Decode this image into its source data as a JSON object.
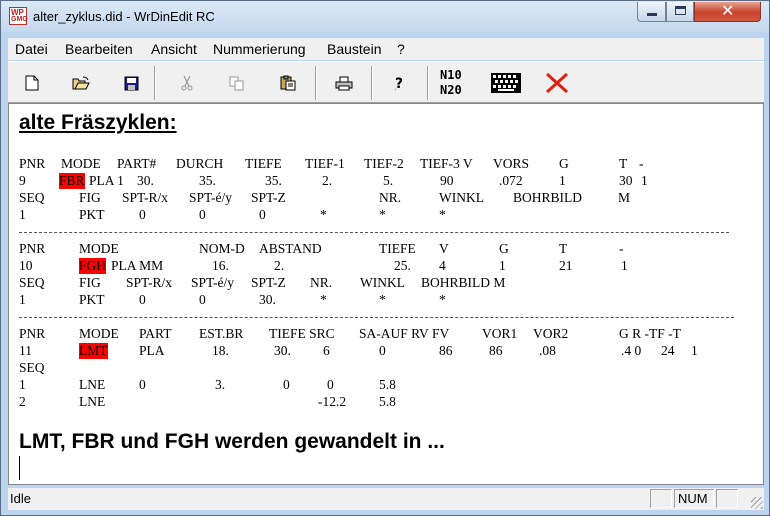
{
  "window": {
    "title": "alter_zyklus.did - WrDinEdit RC",
    "icon_text_top": "WP",
    "icon_text_bottom": "GMG"
  },
  "menu": [
    "Datei",
    "Bearbeiten",
    "Ansicht",
    "Nummerierung",
    "Baustein",
    "?"
  ],
  "toolbar": {
    "buttons": [
      "new-icon",
      "open-icon",
      "save-icon",
      "cut-icon",
      "copy-icon",
      "paste-icon",
      "print-icon",
      "help-icon",
      "n10-n20",
      "keyboard-icon",
      "delete-icon"
    ],
    "n10": "N10",
    "n20": "N20"
  },
  "document": {
    "heading": "alte Fräszyklen:",
    "footer_heading": "LMT, FBR und FGH werden gewandelt in ...",
    "block1": {
      "r1": [
        "PNR",
        "MODE",
        "PART#",
        "DURCH",
        "TIEFE",
        "TIEF-1",
        "TIEF-2",
        "TIEF-3 V",
        "VORS",
        "G",
        "T",
        "-"
      ],
      "r2": [
        "9",
        "FBR",
        "PLA 1",
        "30.",
        "35.",
        "35.",
        "2.",
        "5.",
        "90",
        ".072",
        "1",
        "30",
        "1"
      ],
      "r3": [
        "SEQ",
        "FIG",
        "SPT-R/x",
        "SPT-é/y",
        "SPT-Z",
        "NR.",
        "WINKL",
        "BOHRBILD",
        "M"
      ],
      "r4": [
        "1",
        "PKT",
        "0",
        "0",
        "0",
        "*",
        "*",
        "*"
      ]
    },
    "block2": {
      "r1": [
        "PNR",
        "MODE",
        "NOM-D",
        "ABSTAND",
        "TIEFE",
        "V",
        "G",
        "T",
        "-"
      ],
      "r2": [
        "10",
        "FGH",
        "PLA MM",
        "16.",
        "2.",
        "25.",
        "4",
        "1",
        "21",
        "1"
      ],
      "r3": [
        "SEQ",
        "FIG",
        "SPT-R/x",
        "SPT-é/y",
        "SPT-Z",
        "NR.",
        "WINKL",
        "BOHRBILD M"
      ],
      "r4": [
        "1",
        "PKT",
        "0",
        "0",
        "30.",
        "*",
        "*",
        "*"
      ]
    },
    "block3": {
      "r1": [
        "PNR",
        "MODE",
        "PART",
        "EST.BR",
        "TIEFE SRC",
        "SA-AUF RV FV",
        "VOR1",
        "VOR2",
        "G R -TF -T"
      ],
      "r2": [
        "11",
        "LMT",
        "PLA",
        "18.",
        "30.",
        "6",
        "0",
        "86",
        "86",
        ".08",
        ".4  0",
        "24",
        "1"
      ],
      "r3": [
        "SEQ"
      ],
      "r4": [
        "1",
        "LNE",
        "0",
        "3.",
        "0",
        "0",
        "5.8"
      ],
      "r5": [
        "2",
        "LNE",
        "-12.2",
        "5.8"
      ]
    }
  },
  "status": {
    "text": "Idle",
    "num": "NUM"
  },
  "colors": {
    "highlight": "#ff0000",
    "delete_x": "#e02010"
  }
}
